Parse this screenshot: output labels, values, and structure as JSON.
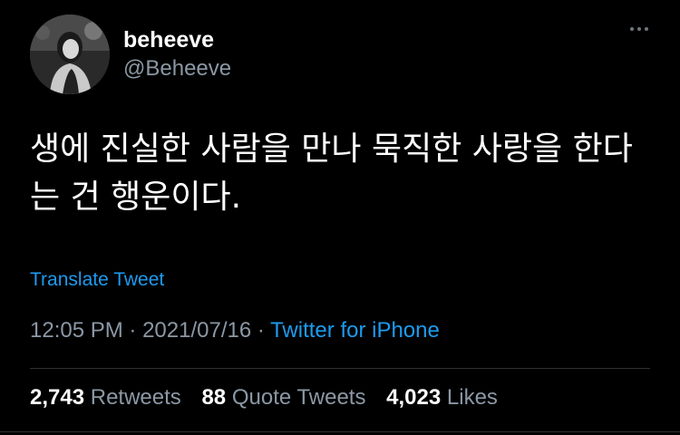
{
  "user": {
    "display_name": "beheeve",
    "handle": "@Beheeve",
    "avatar_icon": "avatar-photo"
  },
  "menu": {
    "icon": "more-icon"
  },
  "tweet": {
    "text": "생에 진실한 사람을 만나 묵직한 사랑을 한다\n는 건 행운이다.",
    "translate_label": "Translate Tweet",
    "time": "12:05 PM",
    "separator": " · ",
    "date": "2021/07/16",
    "source": "Twitter for iPhone"
  },
  "stats": {
    "retweets_count": "2,743",
    "retweets_label": "Retweets",
    "quotes_count": "88",
    "quotes_label": "Quote Tweets",
    "likes_count": "4,023",
    "likes_label": "Likes"
  },
  "colors": {
    "background": "#000000",
    "link": "#1d9bf0",
    "secondary": "#8b98a5"
  }
}
